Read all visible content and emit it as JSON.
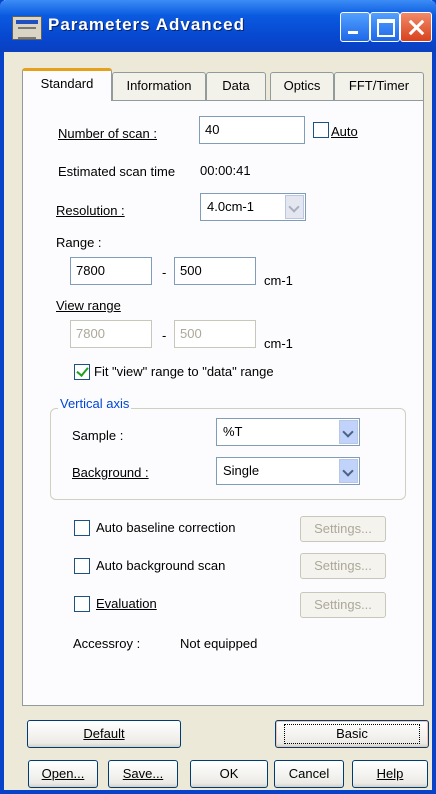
{
  "window": {
    "title": "Parameters  Advanced"
  },
  "tabs": [
    "Standard",
    "Information",
    "Data",
    "Optics",
    "FFT/Timer"
  ],
  "standard": {
    "num_scan_label": "Number of scan :",
    "num_scan_value": "40",
    "auto_label": "Auto",
    "est_time_label": "Estimated scan time",
    "est_time_value": "00:00:41",
    "resolution_label": "Resolution :",
    "resolution_value": "4.0cm-1",
    "range_label": "Range :",
    "range_from": "7800",
    "range_to": "500",
    "range_unit": "cm-1",
    "view_range_label": "View range",
    "view_from": "7800",
    "view_to": "500",
    "view_unit": "cm-1",
    "dash": "-",
    "fit_label": "Fit \"view\" range to \"data\" range",
    "vertical_axis": {
      "title": "Vertical axis",
      "sample_label": "Sample :",
      "sample_value": "%T",
      "background_label": "Background :",
      "background_value": "Single"
    },
    "auto_baseline_label": "Auto baseline correction",
    "auto_background_label": "Auto background scan",
    "evaluation_label": "Evaluation",
    "settings_label": "Settings...",
    "accessory_label": "Accessroy :",
    "accessory_value": "Not equipped"
  },
  "buttons": {
    "default": "Default",
    "basic": "Basic",
    "open": "Open...",
    "save": "Save...",
    "ok": "OK",
    "cancel": "Cancel",
    "help": "Help"
  }
}
